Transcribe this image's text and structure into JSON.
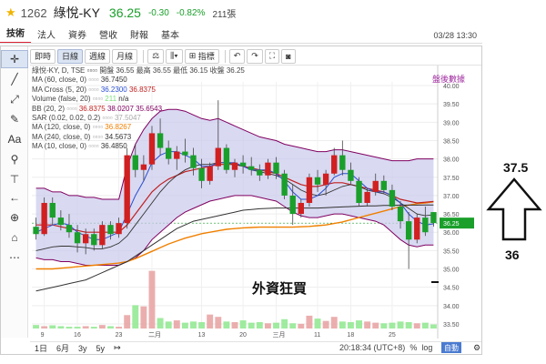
{
  "header": {
    "code": "1262",
    "name": "綠悅-KY",
    "price": "36.25",
    "change": "-0.30",
    "change_pct": "-0.82%",
    "volume": "211張",
    "datetime": "03/28 13:30"
  },
  "tabs": [
    {
      "label": "技術",
      "active": true
    },
    {
      "label": "法人",
      "active": false
    },
    {
      "label": "資券",
      "active": false
    },
    {
      "label": "營收",
      "active": false
    },
    {
      "label": "財報",
      "active": false
    },
    {
      "label": "基本",
      "active": false
    }
  ],
  "toolbar": {
    "intervals": [
      "即時",
      "日線",
      "週線",
      "月線"
    ],
    "active_interval": "日線",
    "indicator_label": "指標"
  },
  "legend": {
    "title": "綠悅-KY, D, TSE",
    "ohlc": "開盤 36.55 最高 36.55 最低 36.15 收盤 36.25",
    "pairs": [
      {
        "label": "MA (60, close, 0)",
        "value": "36.7450",
        "color": "#333333"
      },
      {
        "label": "MA Cross (5, 20)",
        "value": "36.2300",
        "value2": "36.8375",
        "color": "#2a4fd0",
        "color2": "#c02020"
      },
      {
        "label": "Volume (false, 20)",
        "value": "211",
        "value2": "n/a",
        "color": "#7de07d",
        "color2": "#333333"
      },
      {
        "label": "BB (20, 2)",
        "value": "36.8375",
        "value2": "38.0207",
        "value3": "35.6543",
        "color": "#c02020",
        "color2": "#800060",
        "color3": "#800060"
      },
      {
        "label": "SAR (0.02, 0.02, 0.2)",
        "value": "37.5047",
        "color": "#aaaaaa"
      },
      {
        "label": "MA (120, close, 0)",
        "value": "36.8267",
        "color": "#f08000"
      },
      {
        "label": "MA (240, close, 0)",
        "value": "34.5673",
        "color": "#333333"
      },
      {
        "label": "MA (10, close, 0)",
        "value": "36.4850",
        "color": "#333333"
      }
    ],
    "tag": "盤後數據"
  },
  "annotation": {
    "text": "外資狂買",
    "right_top": "37.5",
    "right_bottom": "36"
  },
  "bottom": {
    "ranges": [
      "1日",
      "6月",
      "3y",
      "5y"
    ],
    "clock": "20:18:34 (UTC+8)",
    "pct_label": "%",
    "log_label": "log",
    "auto_label": "自動"
  },
  "chart_data": {
    "type": "candlestick",
    "yaxis_ticks": [
      "40.00",
      "39.50",
      "39.00",
      "38.50",
      "38.00",
      "37.50",
      "37.00",
      "36.50",
      "36.25",
      "36.00",
      "35.50",
      "35.00",
      "34.50",
      "34.00",
      "33.50"
    ],
    "ylim": [
      33.4,
      40.1
    ],
    "last_price": 36.25,
    "xaxis_ticks": [
      "9",
      "16",
      "23",
      "二月",
      "13",
      "20",
      "三月",
      "11",
      "18",
      "25"
    ],
    "colors": {
      "up": "#d02020",
      "down": "#1a9f2a",
      "bb_fill": "#c9c9ec",
      "ma120": "#f08000",
      "ma5": "#2a4fd0",
      "ma20": "#c02020",
      "bb_band": "#800060"
    },
    "candles": [
      {
        "o": 36.15,
        "h": 36.4,
        "l": 35.8,
        "c": 35.95
      },
      {
        "o": 35.95,
        "h": 36.95,
        "l": 35.9,
        "c": 36.8
      },
      {
        "o": 36.8,
        "h": 36.95,
        "l": 36.2,
        "c": 36.4
      },
      {
        "o": 36.4,
        "h": 36.6,
        "l": 36.05,
        "c": 36.2
      },
      {
        "o": 36.2,
        "h": 36.5,
        "l": 35.85,
        "c": 36.0
      },
      {
        "o": 36.0,
        "h": 36.2,
        "l": 35.45,
        "c": 35.7
      },
      {
        "o": 35.7,
        "h": 36.1,
        "l": 35.4,
        "c": 35.95
      },
      {
        "o": 35.95,
        "h": 36.1,
        "l": 35.5,
        "c": 35.65
      },
      {
        "o": 35.65,
        "h": 36.3,
        "l": 35.55,
        "c": 36.2
      },
      {
        "o": 36.2,
        "h": 36.3,
        "l": 35.8,
        "c": 35.95
      },
      {
        "o": 35.95,
        "h": 36.4,
        "l": 35.85,
        "c": 36.25
      },
      {
        "o": 36.25,
        "h": 38.3,
        "l": 36.1,
        "c": 38.1
      },
      {
        "o": 38.1,
        "h": 38.4,
        "l": 37.5,
        "c": 37.7
      },
      {
        "o": 37.7,
        "h": 38.1,
        "l": 37.4,
        "c": 37.85
      },
      {
        "o": 37.85,
        "h": 38.9,
        "l": 37.7,
        "c": 38.7
      },
      {
        "o": 38.7,
        "h": 39.1,
        "l": 38.1,
        "c": 38.3
      },
      {
        "o": 38.3,
        "h": 38.5,
        "l": 37.85,
        "c": 38.0
      },
      {
        "o": 38.0,
        "h": 38.35,
        "l": 37.7,
        "c": 38.2
      },
      {
        "o": 38.2,
        "h": 38.55,
        "l": 37.9,
        "c": 38.1
      },
      {
        "o": 38.1,
        "h": 38.3,
        "l": 37.55,
        "c": 37.75
      },
      {
        "o": 37.75,
        "h": 38.0,
        "l": 37.2,
        "c": 37.4
      },
      {
        "o": 37.4,
        "h": 37.9,
        "l": 37.3,
        "c": 37.8
      },
      {
        "o": 37.8,
        "h": 39.6,
        "l": 37.7,
        "c": 38.3
      },
      {
        "o": 38.3,
        "h": 38.4,
        "l": 37.6,
        "c": 37.7
      },
      {
        "o": 37.7,
        "h": 38.0,
        "l": 37.5,
        "c": 37.9
      },
      {
        "o": 37.9,
        "h": 38.1,
        "l": 37.6,
        "c": 37.8
      },
      {
        "o": 37.8,
        "h": 38.05,
        "l": 37.55,
        "c": 37.7
      },
      {
        "o": 37.7,
        "h": 37.85,
        "l": 37.4,
        "c": 37.55
      },
      {
        "o": 37.55,
        "h": 38.0,
        "l": 37.45,
        "c": 37.9
      },
      {
        "o": 37.9,
        "h": 38.05,
        "l": 37.45,
        "c": 37.6
      },
      {
        "o": 37.6,
        "h": 37.7,
        "l": 36.9,
        "c": 37.0
      },
      {
        "o": 37.0,
        "h": 37.3,
        "l": 36.2,
        "c": 36.5
      },
      {
        "o": 36.5,
        "h": 36.9,
        "l": 36.4,
        "c": 36.8
      },
      {
        "o": 36.8,
        "h": 37.6,
        "l": 36.7,
        "c": 37.5
      },
      {
        "o": 37.5,
        "h": 37.7,
        "l": 37.1,
        "c": 37.3
      },
      {
        "o": 37.3,
        "h": 37.7,
        "l": 37.0,
        "c": 37.6
      },
      {
        "o": 37.6,
        "h": 38.3,
        "l": 37.55,
        "c": 38.1
      },
      {
        "o": 38.1,
        "h": 38.5,
        "l": 37.55,
        "c": 37.7
      },
      {
        "o": 37.7,
        "h": 37.9,
        "l": 37.3,
        "c": 37.4
      },
      {
        "o": 37.4,
        "h": 37.5,
        "l": 36.7,
        "c": 36.8
      },
      {
        "o": 36.8,
        "h": 37.2,
        "l": 36.7,
        "c": 37.1
      },
      {
        "o": 37.1,
        "h": 37.6,
        "l": 37.0,
        "c": 37.4
      },
      {
        "o": 37.4,
        "h": 37.55,
        "l": 37.05,
        "c": 37.15
      },
      {
        "o": 37.15,
        "h": 37.3,
        "l": 36.6,
        "c": 36.7
      },
      {
        "o": 36.7,
        "h": 36.85,
        "l": 36.1,
        "c": 36.3
      },
      {
        "o": 36.3,
        "h": 36.55,
        "l": 35.0,
        "c": 35.8
      },
      {
        "o": 35.8,
        "h": 36.5,
        "l": 35.7,
        "c": 36.4
      },
      {
        "o": 36.4,
        "h": 36.7,
        "l": 35.9,
        "c": 36.0
      },
      {
        "o": 36.55,
        "h": 36.55,
        "l": 36.15,
        "c": 36.25
      }
    ],
    "volume_ylim": [
      0,
      1000
    ],
    "volumes": [
      60,
      40,
      55,
      40,
      30,
      30,
      40,
      30,
      60,
      40,
      30,
      230,
      400,
      380,
      990,
      180,
      120,
      140,
      100,
      120,
      110,
      240,
      200,
      120,
      110,
      140,
      100,
      110,
      90,
      100,
      160,
      90,
      80,
      220,
      170,
      130,
      200,
      120,
      110,
      140,
      120,
      100,
      90,
      100,
      120,
      110,
      90,
      100,
      70
    ],
    "bb_upper": [
      37.2,
      37.2,
      37.1,
      37.1,
      37.0,
      37.0,
      36.95,
      36.95,
      36.9,
      36.9,
      36.9,
      37.8,
      38.4,
      38.8,
      39.1,
      39.3,
      39.35,
      39.35,
      39.3,
      39.2,
      39.1,
      39.05,
      39.1,
      39.0,
      38.9,
      38.8,
      38.7,
      38.6,
      38.55,
      38.5,
      38.4,
      38.35,
      38.3,
      38.25,
      38.2,
      38.2,
      38.25,
      38.25,
      38.2,
      38.15,
      38.1,
      38.05,
      38.0,
      37.95,
      37.95,
      37.95,
      38.0,
      38.0,
      38.0
    ],
    "bb_lower": [
      35.3,
      35.25,
      35.25,
      35.2,
      35.2,
      35.15,
      35.1,
      35.1,
      35.1,
      35.1,
      35.1,
      35.2,
      35.3,
      35.5,
      35.8,
      36.0,
      36.2,
      36.4,
      36.55,
      36.65,
      36.75,
      36.85,
      36.9,
      36.95,
      37.0,
      37.0,
      37.0,
      36.95,
      36.9,
      36.85,
      36.7,
      36.55,
      36.45,
      36.4,
      36.4,
      36.45,
      36.5,
      36.5,
      36.45,
      36.4,
      36.35,
      36.3,
      36.2,
      36.0,
      35.8,
      35.65,
      35.6,
      35.65,
      35.65
    ],
    "ma20": [
      36.2,
      36.2,
      36.2,
      36.15,
      36.1,
      36.05,
      36.0,
      36.0,
      36.0,
      36.0,
      36.0,
      36.2,
      36.5,
      36.8,
      37.1,
      37.3,
      37.45,
      37.55,
      37.65,
      37.7,
      37.75,
      37.8,
      37.85,
      37.85,
      37.85,
      37.8,
      37.75,
      37.7,
      37.65,
      37.6,
      37.5,
      37.4,
      37.3,
      37.25,
      37.25,
      37.3,
      37.35,
      37.35,
      37.3,
      37.25,
      37.2,
      37.15,
      37.1,
      37.0,
      36.9,
      36.85,
      36.8,
      36.82,
      36.84
    ],
    "ma5": [
      36.0,
      36.1,
      36.2,
      36.25,
      36.2,
      36.0,
      35.9,
      35.8,
      35.8,
      35.9,
      36.0,
      36.5,
      37.0,
      37.4,
      37.9,
      38.1,
      38.2,
      38.2,
      38.1,
      38.0,
      37.8,
      37.8,
      37.9,
      37.9,
      37.9,
      37.8,
      37.7,
      37.7,
      37.7,
      37.6,
      37.4,
      37.1,
      36.9,
      36.9,
      37.0,
      37.2,
      37.5,
      37.6,
      37.6,
      37.4,
      37.2,
      37.1,
      37.1,
      37.0,
      36.8,
      36.5,
      36.3,
      36.2,
      36.23
    ],
    "ma120": [
      35.0,
      35.0,
      35.0,
      35.02,
      35.04,
      35.06,
      35.08,
      35.1,
      35.12,
      35.14,
      35.16,
      35.2,
      35.28,
      35.38,
      35.48,
      35.58,
      35.68,
      35.76,
      35.84,
      35.9,
      35.96,
      36.0,
      36.04,
      36.08,
      36.1,
      36.12,
      36.13,
      36.14,
      36.14,
      36.14,
      36.14,
      36.14,
      36.15,
      36.16,
      36.18,
      36.2,
      36.24,
      36.28,
      36.34,
      36.4,
      36.46,
      36.52,
      36.58,
      36.64,
      36.7,
      36.74,
      36.78,
      36.8,
      36.83
    ],
    "ma240": [
      34.4,
      34.45,
      34.5,
      34.55,
      34.6,
      34.65,
      34.7,
      34.8,
      34.9,
      35.0,
      35.1,
      35.2,
      35.35,
      35.5,
      35.65,
      35.8,
      35.95,
      36.1,
      36.2,
      36.3,
      36.35,
      36.4,
      36.45,
      36.5,
      36.55,
      36.6,
      36.62,
      36.64,
      36.65,
      36.66,
      36.66,
      36.66,
      36.66,
      36.66,
      36.66,
      36.67,
      36.68,
      36.69,
      36.7,
      36.71,
      36.72,
      36.72,
      36.73,
      36.73,
      36.74,
      36.74,
      36.74,
      36.745,
      36.745
    ],
    "ma10": [
      35.5,
      35.55,
      35.6,
      35.62,
      35.62,
      35.6,
      35.58,
      35.55,
      35.55,
      35.6,
      35.7,
      35.9,
      36.2,
      36.5,
      36.8,
      37.1,
      37.35,
      37.55,
      37.7,
      37.8,
      37.85,
      37.85,
      37.9,
      37.9,
      37.85,
      37.8,
      37.7,
      37.65,
      37.6,
      37.55,
      37.45,
      37.3,
      37.15,
      37.05,
      37.0,
      37.05,
      37.15,
      37.25,
      37.3,
      37.25,
      37.15,
      37.1,
      37.05,
      36.95,
      36.8,
      36.65,
      36.5,
      36.45,
      36.48
    ]
  }
}
